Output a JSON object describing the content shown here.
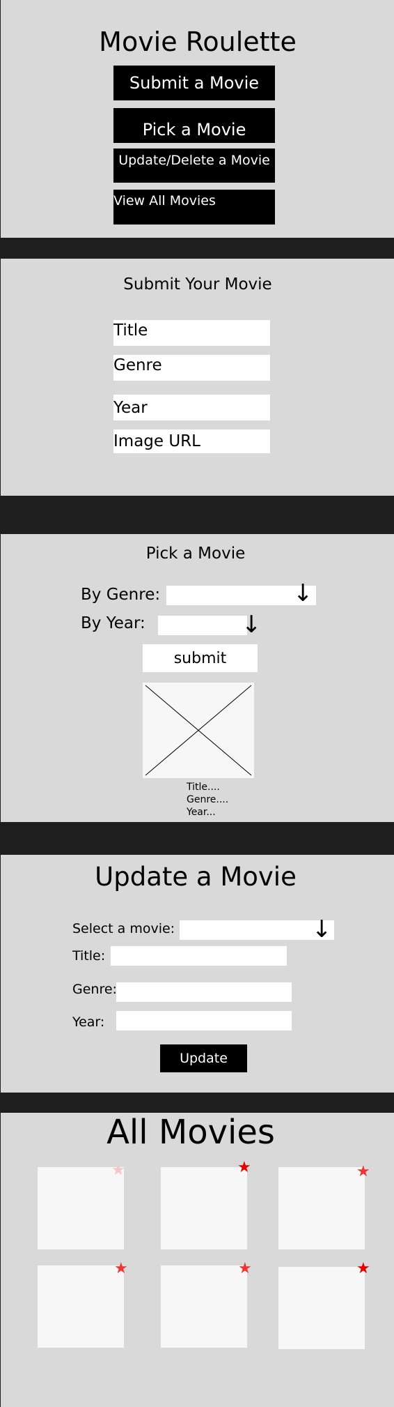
{
  "app": {
    "title": "Movie Roulette"
  },
  "menu": {
    "submit_label": "Submit a Movie",
    "pick_label": "Pick a Movie",
    "update_label": "Update/Delete a Movie",
    "view_all_label": "View All Movies"
  },
  "submit_section": {
    "title": "Submit Your Movie",
    "title_placeholder": "Title",
    "genre_placeholder": "Genre",
    "year_placeholder": "Year",
    "image_url_placeholder": "Image URL"
  },
  "pick_section": {
    "title": "Pick a Movie",
    "genre_label": "By Genre:",
    "year_label": "By Year:",
    "submit_label": "submit",
    "result": {
      "title": "Title....",
      "genre": "Genre....",
      "year": "Year..."
    }
  },
  "update_section": {
    "title": "Update a Movie",
    "select_label": "Select a movie:",
    "title_label": "Title:",
    "genre_label": "Genre:",
    "year_label": "Year:",
    "update_label": "Update"
  },
  "all_movies": {
    "title": "All Movies",
    "cards": [
      {
        "star_color": "#f5c6c6"
      },
      {
        "star_color": "#e60000"
      },
      {
        "star_color": "#ee3333"
      },
      {
        "star_color": "#ee3333"
      },
      {
        "star_color": "#ee3333"
      },
      {
        "star_color": "#e60000"
      }
    ]
  },
  "colors": {
    "background": "#d9d9d9",
    "separator": "#1e1e1e",
    "button": "#000000",
    "button_text": "#ffffff",
    "card": "#f7f7f7",
    "star": "#e60000"
  },
  "icons": {
    "dropdown": "arrow-down-icon",
    "favorite": "star-icon",
    "image_placeholder": "image-placeholder-icon"
  }
}
